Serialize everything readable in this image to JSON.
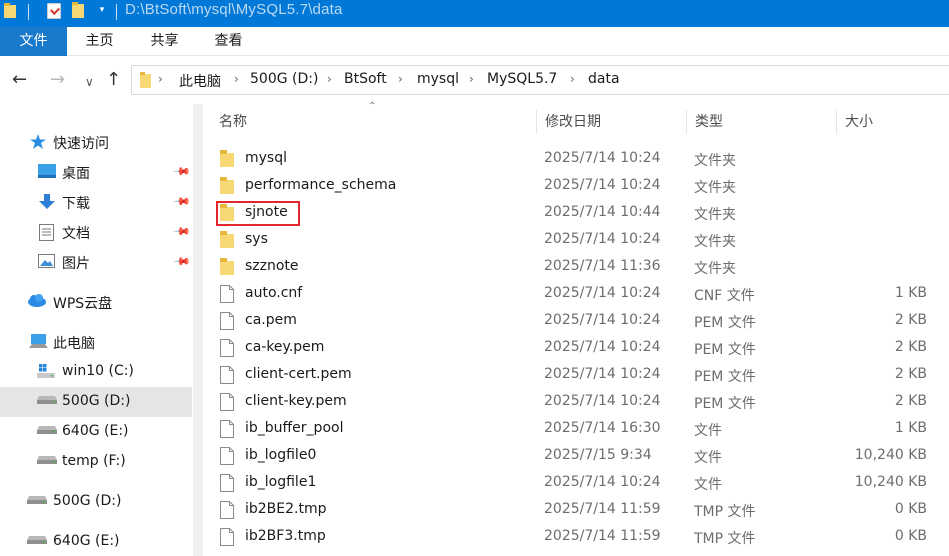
{
  "window": {
    "title": "D:\\BtSoft\\mysql\\MySQL5.7\\data"
  },
  "ribbon": {
    "tabs": [
      {
        "label": "文件"
      },
      {
        "label": "主页"
      },
      {
        "label": "共享"
      },
      {
        "label": "查看"
      }
    ]
  },
  "address": {
    "crumbs": [
      "此电脑",
      "500G (D:)",
      "BtSoft",
      "mysql",
      "MySQL5.7",
      "data"
    ]
  },
  "sidebar": {
    "items": [
      {
        "label": "快速访问",
        "icon": "star-icon"
      },
      {
        "label": "桌面",
        "icon": "desktop-icon",
        "pinned": true
      },
      {
        "label": "下载",
        "icon": "download-icon",
        "pinned": true
      },
      {
        "label": "文档",
        "icon": "document-icon",
        "pinned": true
      },
      {
        "label": "图片",
        "icon": "pictures-icon",
        "pinned": true
      },
      {
        "label": "WPS云盘",
        "icon": "cloud-icon"
      },
      {
        "label": "此电脑",
        "icon": "computer-icon"
      },
      {
        "label": "win10 (C:)",
        "icon": "windows-drive-icon"
      },
      {
        "label": "500G (D:)",
        "icon": "drive-icon",
        "selected": true
      },
      {
        "label": "640G (E:)",
        "icon": "drive-icon"
      },
      {
        "label": "temp (F:)",
        "icon": "drive-icon"
      },
      {
        "label": "500G (D:)",
        "icon": "drive-icon"
      },
      {
        "label": "640G (E:)",
        "icon": "drive-icon"
      }
    ]
  },
  "columns": {
    "name": "名称",
    "date": "修改日期",
    "type": "类型",
    "size": "大小"
  },
  "files": [
    {
      "name": "mysql",
      "date": "2025/7/14 10:24",
      "type": "文件夹",
      "size": "",
      "kind": "folder"
    },
    {
      "name": "performance_schema",
      "date": "2025/7/14 10:24",
      "type": "文件夹",
      "size": "",
      "kind": "folder"
    },
    {
      "name": "sjnote",
      "date": "2025/7/14 10:44",
      "type": "文件夹",
      "size": "",
      "kind": "folder",
      "highlighted": true
    },
    {
      "name": "sys",
      "date": "2025/7/14 10:24",
      "type": "文件夹",
      "size": "",
      "kind": "folder"
    },
    {
      "name": "szznote",
      "date": "2025/7/14 11:36",
      "type": "文件夹",
      "size": "",
      "kind": "folder"
    },
    {
      "name": "auto.cnf",
      "date": "2025/7/14 10:24",
      "type": "CNF 文件",
      "size": "1 KB",
      "kind": "file"
    },
    {
      "name": "ca.pem",
      "date": "2025/7/14 10:24",
      "type": "PEM 文件",
      "size": "2 KB",
      "kind": "file"
    },
    {
      "name": "ca-key.pem",
      "date": "2025/7/14 10:24",
      "type": "PEM 文件",
      "size": "2 KB",
      "kind": "file"
    },
    {
      "name": "client-cert.pem",
      "date": "2025/7/14 10:24",
      "type": "PEM 文件",
      "size": "2 KB",
      "kind": "file"
    },
    {
      "name": "client-key.pem",
      "date": "2025/7/14 10:24",
      "type": "PEM 文件",
      "size": "2 KB",
      "kind": "file"
    },
    {
      "name": "ib_buffer_pool",
      "date": "2025/7/14 16:30",
      "type": "文件",
      "size": "1 KB",
      "kind": "file"
    },
    {
      "name": "ib_logfile0",
      "date": "2025/7/15 9:34",
      "type": "文件",
      "size": "10,240 KB",
      "kind": "file"
    },
    {
      "name": "ib_logfile1",
      "date": "2025/7/14 10:24",
      "type": "文件",
      "size": "10,240 KB",
      "kind": "file"
    },
    {
      "name": "ib2BE2.tmp",
      "date": "2025/7/14 11:59",
      "type": "TMP 文件",
      "size": "0 KB",
      "kind": "file"
    },
    {
      "name": "ib2BF3.tmp",
      "date": "2025/7/14 11:59",
      "type": "TMP 文件",
      "size": "0 KB",
      "kind": "file"
    }
  ],
  "colors": {
    "titlebar": "#0078d7",
    "file_tab": "#1979ca",
    "folder": "#f8d775",
    "highlight": "#e3262b",
    "selected": "#e5e5e5"
  }
}
